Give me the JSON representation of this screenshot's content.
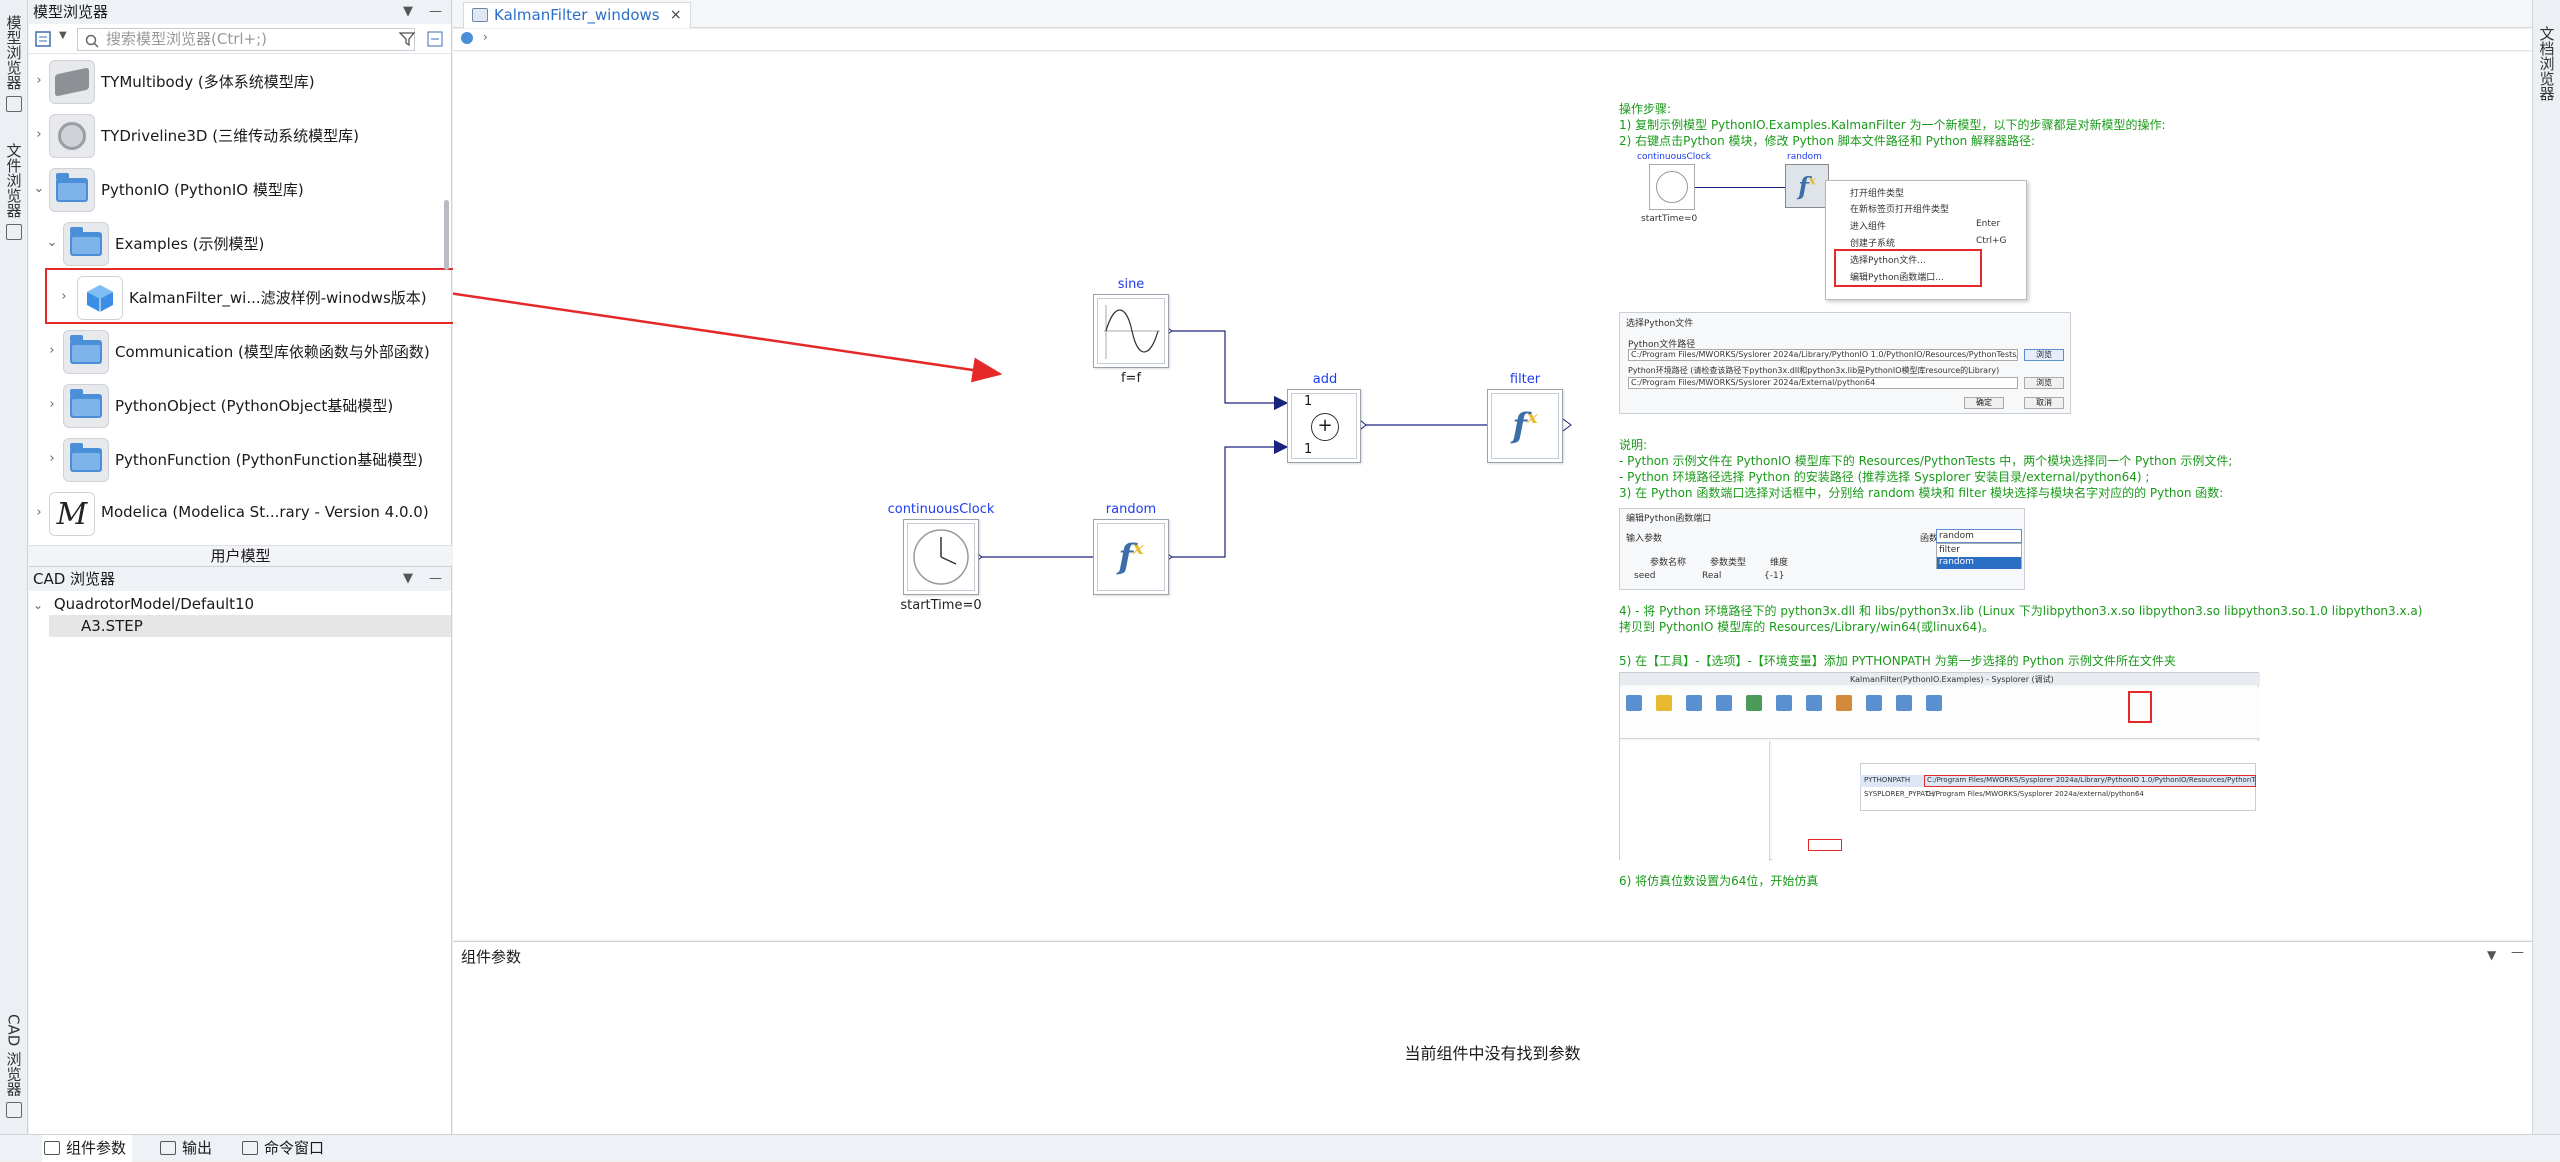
{
  "left_rail": {
    "tabs": [
      {
        "label": "模型浏览器"
      },
      {
        "label": "文件浏览器"
      },
      {
        "label": "CAD 浏览器"
      }
    ]
  },
  "right_rail": {
    "label": "文档浏览器"
  },
  "model_browser": {
    "title": "模型浏览器",
    "search_placeholder": "搜索模型浏览器(Ctrl+;)",
    "items": [
      {
        "label": "TYMultibody (多体系统模型库)",
        "icon": "library-icon"
      },
      {
        "label": "TYDriveline3D (三维传动系统模型库)",
        "icon": "library-icon"
      },
      {
        "label": "PythonIO (PythonIO 模型库)",
        "icon": "folder-icon"
      },
      {
        "label": "Examples (示例模型)",
        "icon": "folder-icon"
      },
      {
        "label": "KalmanFilter_wi...滤波样例-winodws版本)",
        "icon": "model-icon"
      },
      {
        "label": "Communication (模型库依赖函数与外部函数)",
        "icon": "folder-icon"
      },
      {
        "label": "PythonObject (PythonObject基础模型)",
        "icon": "folder-icon"
      },
      {
        "label": "PythonFunction (PythonFunction基础模型)",
        "icon": "folder-icon"
      },
      {
        "label": "Modelica (Modelica St...rary - Version 4.0.0)",
        "icon": "modelica-icon"
      }
    ],
    "footer": "用户模型"
  },
  "cad_browser": {
    "title": "CAD 浏览器",
    "items": [
      {
        "label": "QuadrotorModel/Default10"
      },
      {
        "label": "A3.STEP"
      }
    ]
  },
  "editor": {
    "tab_label": "KalmanFilter_windows",
    "close_glyph": "×"
  },
  "diagram": {
    "blocks": {
      "sine": {
        "name": "sine",
        "param": "f=f"
      },
      "add": {
        "name": "add",
        "in1": "1",
        "in2": "1",
        "symbol": "+"
      },
      "filter": {
        "name": "filter"
      },
      "clock": {
        "name": "continuousClock",
        "param": "startTime=0"
      },
      "random": {
        "name": "random"
      }
    }
  },
  "instructions": {
    "title": "操作步骤:",
    "step1": "1) 复制示例模型 PythonIO.Examples.KalmanFilter 为一个新模型，以下的步骤都是对新模型的操作:",
    "step2": "2) 右键点击Python 模块，修改 Python 脚本文件路径和 Python 解释器路径:",
    "shot1": {
      "clock_label": "continuousClock",
      "random_label": "random",
      "start_label": "startTime=0",
      "menu": [
        {
          "label": "打开组件类型",
          "shortcut": ""
        },
        {
          "label": "在新标签页打开组件类型",
          "shortcut": ""
        },
        {
          "label": "进入组件",
          "shortcut": "Enter"
        },
        {
          "label": "创建子系统",
          "shortcut": "Ctrl+G"
        },
        {
          "label": "选择Python文件...",
          "shortcut": ""
        },
        {
          "label": "编辑Python函数端口...",
          "shortcut": ""
        }
      ]
    },
    "shot2": {
      "title": "选择Python文件",
      "label1": "Python文件路径",
      "path1": "C:/Program Files/MWORKS/Syslorer 2024a/Library/PythonIO 1.0/PythonIO/Resources/PythonTests/KalmanFilter.py",
      "label2": "Python环境路径 (请检查该路径下python3x.dll和python3x.lib是PythonIO模型库resource的Library)",
      "path2": "C:/Program Files/MWORKS/Syslorer 2024a/External/python64",
      "btn_browse": "浏览",
      "btn_ok": "确定",
      "btn_cancel": "取消"
    },
    "desc_title": "说明:",
    "desc1": " - Python 示例文件在 PythonIO 模型库下的 Resources/PythonTests 中，两个模块选择同一个 Python 示例文件;",
    "desc2": " - Python 环境路径选择 Python 的安装路径 (推荐选择 Sysplorer 安装目录/external/python64) ;",
    "step3": "3) 在 Python 函数端口选择对话框中，分别给 random 模块和 filter 模块选择与模块名字对应的的 Python 函数:",
    "shot3": {
      "title": "编辑Python函数端口",
      "input_label": "输入参数",
      "func_label": "函数",
      "func_value": "random",
      "options": [
        "filter",
        "random"
      ],
      "headers": [
        "参数名称",
        "参数类型",
        "维度"
      ],
      "row": [
        "seed",
        "Real",
        "{-1}"
      ]
    },
    "step4a": "4)  - 将 Python 环境路径下的 python3x.dll 和 libs/python3x.lib (Linux 下为libpython3.x.so libpython3.so libpython3.so.1.0 libpython3.x.a)",
    "step4b": "拷贝到 PythonIO 模型库的 Resources/Library/win64(或linux64)。",
    "step5": "5) 在【工具】-【选项】-【环境变量】添加 PYTHONPATH 为第一步选择的 Python 示例文件所在文件夹",
    "shot4": {
      "title": "KalmanFilter(PythonIO.Examples) - Sysplorer (调试)",
      "var_name": "PYTHONPATH",
      "var_value": "C:/Program Files/MWORKS/Sysplorer 2024a/Library/PythonIO 1.0/PythonIO/Resources/PythonTests",
      "var_name2": "SYSPLORER_PYPATH",
      "var_value2": "C:/Program Files/MWORKS/Sysplorer 2024a/external/python64"
    },
    "step6": "6) 将仿真位数设置为64位，开始仿真"
  },
  "props": {
    "title": "组件参数",
    "empty_text": "当前组件中没有找到参数"
  },
  "bottom_tabs": [
    {
      "label": "组件参数"
    },
    {
      "label": "输出"
    },
    {
      "label": "命令窗口"
    }
  ],
  "colors": {
    "accent": "#2a6ec6",
    "block_label": "#1e3cf0",
    "wire": "#1a237e",
    "annotation": "#1a9a1a",
    "highlight": "#e52828"
  }
}
